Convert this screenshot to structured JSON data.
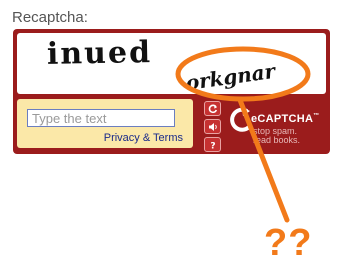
{
  "label": "Recaptcha:",
  "captcha": {
    "word_1": "inued",
    "word_2": "orkgnar"
  },
  "answer": {
    "placeholder": "Type the text",
    "value": "",
    "privacy_link": "Privacy & Terms"
  },
  "controls": [
    {
      "icon": "refresh-icon"
    },
    {
      "icon": "audio-icon"
    },
    {
      "icon": "help-icon"
    }
  ],
  "brand": {
    "name": "eCAPTCHA",
    "trademark": "™",
    "tagline_1": "stop spam.",
    "tagline_2": "read books."
  },
  "annotation": {
    "text": "??",
    "color": "#f27a1a"
  },
  "colors": {
    "widget_bg": "#9b1c1c",
    "panel_bg": "#fbe8a8",
    "link": "#1a2a8a",
    "accent": "#f27a1a"
  }
}
